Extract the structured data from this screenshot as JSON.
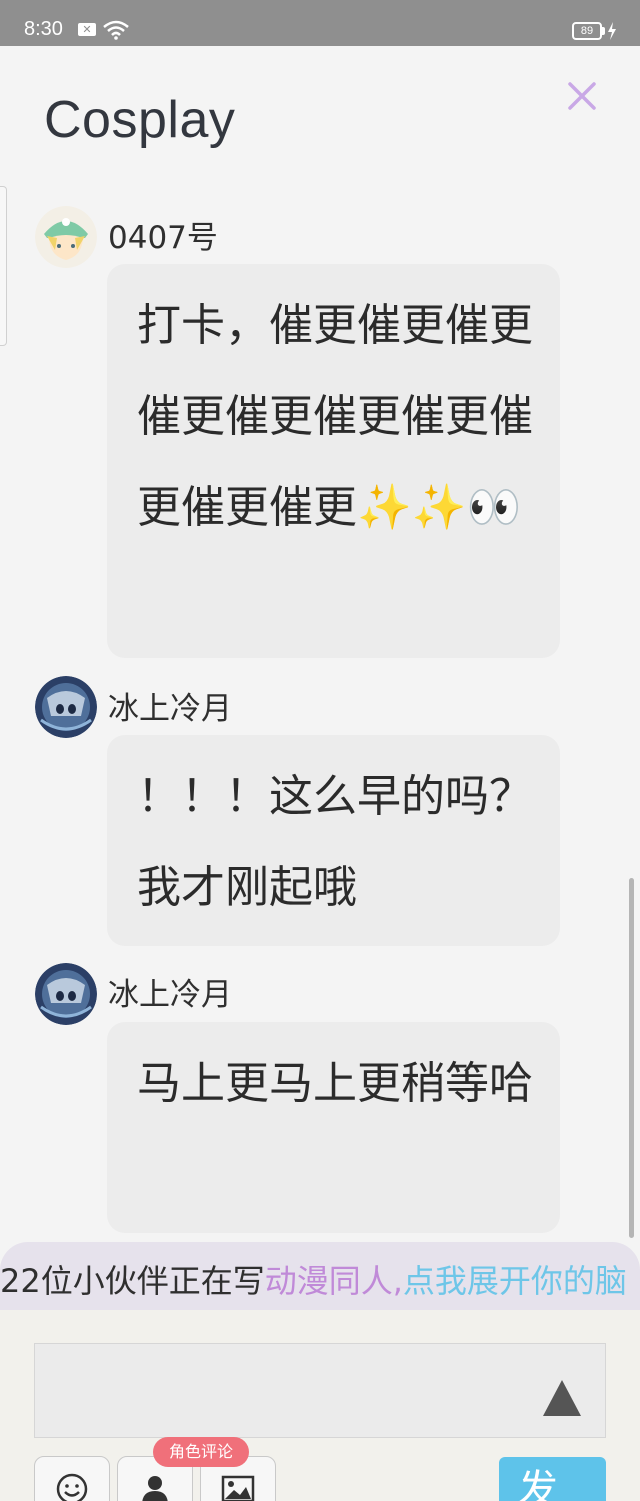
{
  "status_bar": {
    "time": "8:30",
    "battery": "89"
  },
  "header": {
    "title": "Cosplay"
  },
  "comments": [
    {
      "username": "0407号",
      "text": "打卡，催更催更催更催更催更催更催更催更催更催更✨✨👀"
    },
    {
      "username": "冰上冷月",
      "text": "！！！这么早的吗？我才刚起哦"
    },
    {
      "username": "冰上冷月",
      "text": "马上更马上更稍等哈"
    }
  ],
  "ticker": {
    "part1": "22位小伙伴正在写",
    "part2": "动漫同人,",
    "part3": "点我展开你的脑"
  },
  "composer": {
    "role_comment_badge": "角色评论",
    "send_label": "发"
  },
  "colors": {
    "status_bar": "#8f8f8f",
    "accent_purple": "#c08ad8",
    "accent_blue": "#6ec6e8",
    "badge_red": "#f0707a",
    "send_button": "#5ec3ea"
  },
  "icons": [
    "wifi-icon",
    "battery-icon",
    "close-icon",
    "emoji-icon",
    "person-icon",
    "image-icon",
    "send-triangle-icon"
  ]
}
